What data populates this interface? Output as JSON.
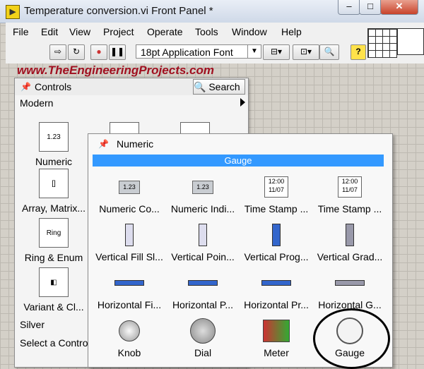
{
  "window": {
    "title": "Temperature conversion.vi Front Panel *",
    "app_icon": "labview-icon",
    "min": "–",
    "max": "□",
    "close": "✕"
  },
  "menu": [
    "File",
    "Edit",
    "View",
    "Project",
    "Operate",
    "Tools",
    "Window",
    "Help"
  ],
  "toolbar": {
    "font": "18pt Application Font",
    "help": "?",
    "run": "⇨",
    "run_continuous": "↻",
    "abort": "●",
    "pause": "❚❚"
  },
  "watermark": "www.TheEngineeringProjects.com",
  "controls_palette": {
    "title": "Controls",
    "search": "Search",
    "section": "Modern",
    "categories": [
      {
        "label": "Numeric",
        "icon": "1.23"
      },
      {
        "label": "Array, Matrix...",
        "icon": "[]"
      },
      {
        "label": "Ring & Enum",
        "icon": "Ring"
      },
      {
        "label": "Variant & Cl...",
        "icon": "◧"
      }
    ],
    "boolean_icon": "abc",
    "silver": "Silver",
    "select": "Select a Contro"
  },
  "numeric_palette": {
    "title": "Numeric",
    "highlight": "Gauge",
    "items": [
      {
        "label": "Numeric Co...",
        "icon": "1.23"
      },
      {
        "label": "Numeric Indi...",
        "icon": "1.23"
      },
      {
        "label": "Time Stamp ...",
        "icon": "12:00 11/07"
      },
      {
        "label": "Time Stamp ...",
        "icon": "12:00 11/07"
      },
      {
        "label": "Vertical Fill Sl...",
        "icon": "v"
      },
      {
        "label": "Vertical Poin...",
        "icon": "v"
      },
      {
        "label": "Vertical Prog...",
        "icon": "v"
      },
      {
        "label": "Vertical Grad...",
        "icon": "v"
      },
      {
        "label": "Horizontal Fi...",
        "icon": "h"
      },
      {
        "label": "Horizontal P...",
        "icon": "h"
      },
      {
        "label": "Horizontal Pr...",
        "icon": "h"
      },
      {
        "label": "Horizontal G...",
        "icon": "h"
      },
      {
        "label": "Knob",
        "icon": "knob"
      },
      {
        "label": "Dial",
        "icon": "dial"
      },
      {
        "label": "Meter",
        "icon": "meter"
      },
      {
        "label": "Gauge",
        "icon": "gauge"
      }
    ]
  }
}
